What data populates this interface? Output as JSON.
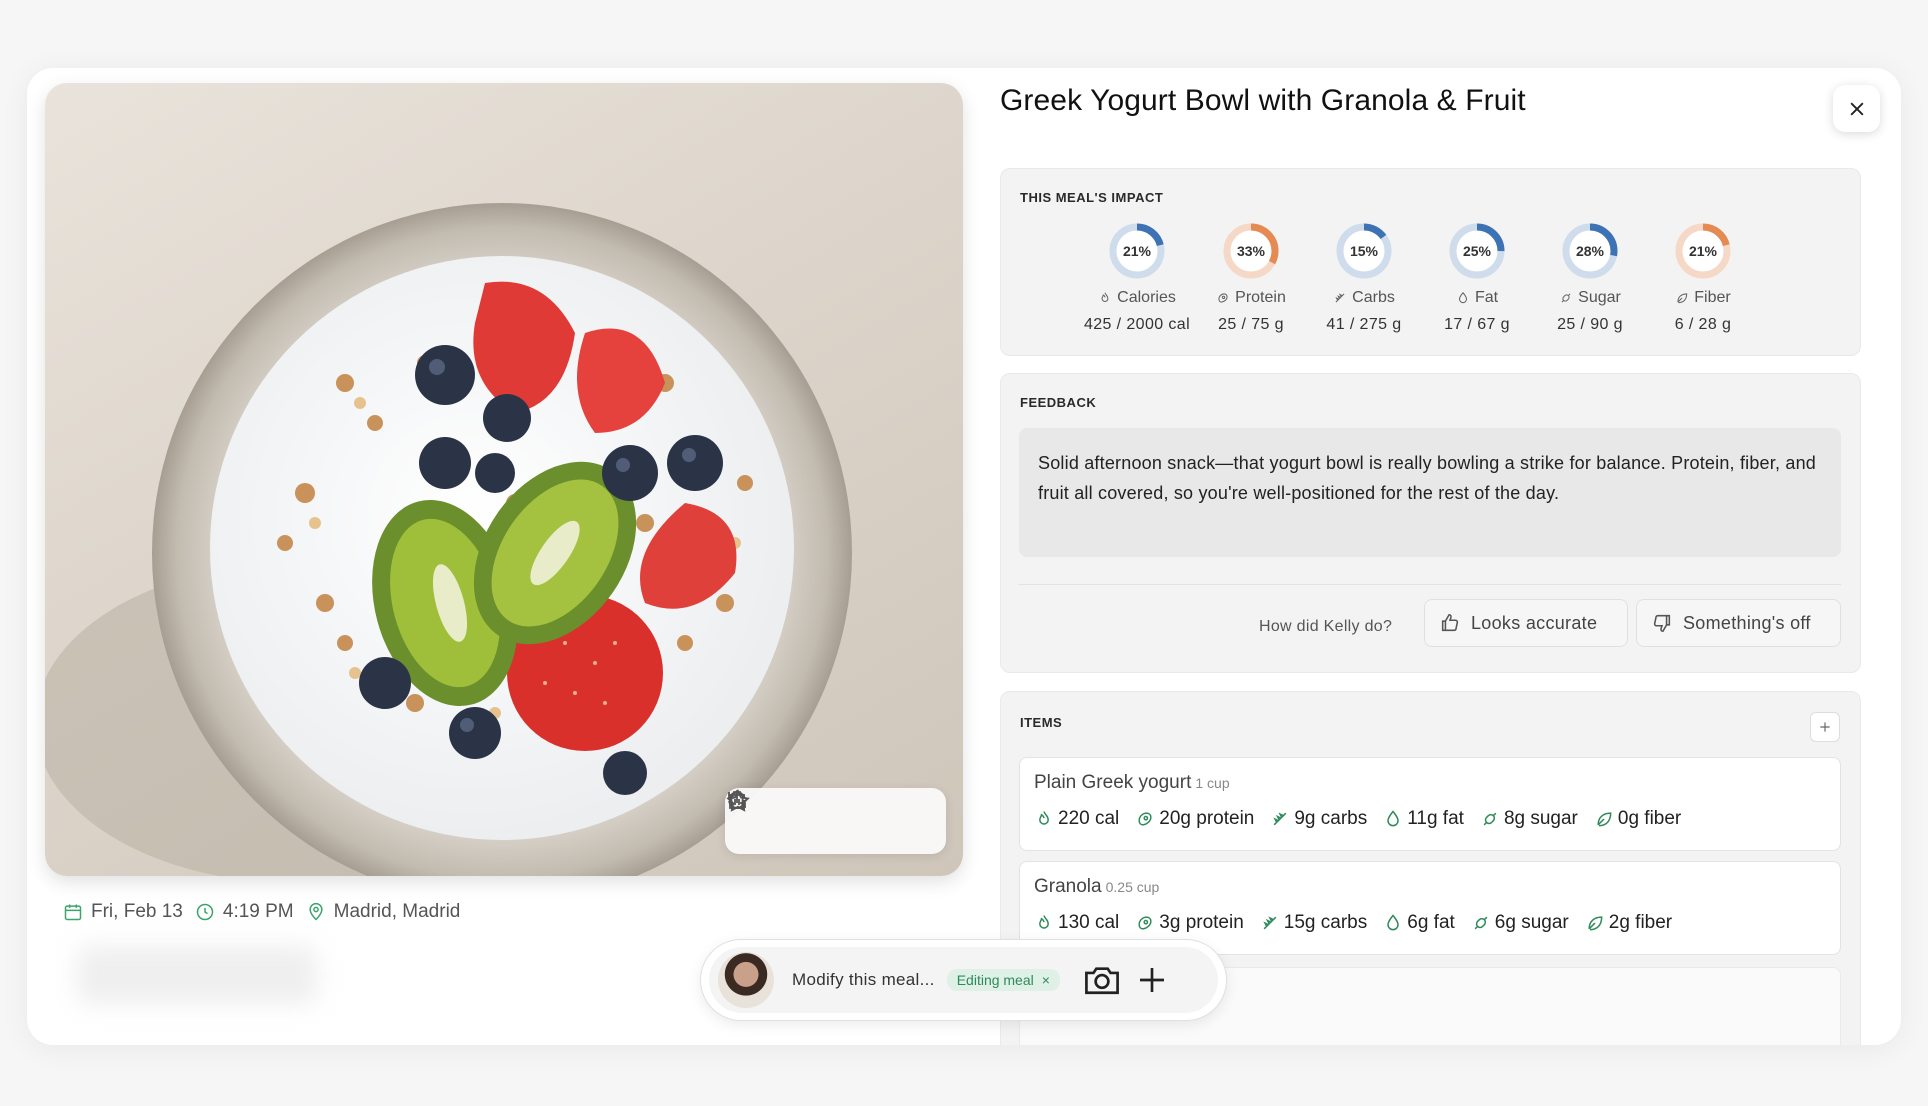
{
  "meal": {
    "title": "Greek Yogurt Bowl with Granola & Fruit"
  },
  "meta": {
    "date": "Fri, Feb 13",
    "time": "4:19 PM",
    "location": "Madrid, Madrid"
  },
  "impact": {
    "heading": "THIS MEAL'S IMPACT",
    "metrics": [
      {
        "pct": "21%",
        "label": "Calories",
        "value": "425 / 2000 cal",
        "icon": "flame-icon",
        "fraction": 0.21,
        "color": "#3d72b4"
      },
      {
        "pct": "33%",
        "label": "Protein",
        "value": "25 / 75 g",
        "icon": "steak-icon",
        "fraction": 0.33,
        "color": "#e58a53"
      },
      {
        "pct": "15%",
        "label": "Carbs",
        "value": "41 / 275 g",
        "icon": "wheat-icon",
        "fraction": 0.15,
        "color": "#3d72b4"
      },
      {
        "pct": "25%",
        "label": "Fat",
        "value": "17 / 67 g",
        "icon": "drop-icon",
        "fraction": 0.25,
        "color": "#3d72b4"
      },
      {
        "pct": "28%",
        "label": "Sugar",
        "value": "25 / 90 g",
        "icon": "candy-icon",
        "fraction": 0.28,
        "color": "#3d72b4"
      },
      {
        "pct": "21%",
        "label": "Fiber",
        "value": "6 / 28 g",
        "icon": "leaf-icon",
        "fraction": 0.21,
        "color": "#e58a53"
      }
    ]
  },
  "feedback": {
    "heading": "FEEDBACK",
    "text": "Solid afternoon snack—that yogurt bowl is really bowling a strike for balance. Protein, fiber, and fruit all covered, so you're well-positioned for the rest of the day.",
    "question": "How did Kelly do?",
    "accurate_label": "Looks accurate",
    "off_label": "Something's off"
  },
  "items": {
    "heading": "ITEMS",
    "list": [
      {
        "name": "Plain Greek yogurt",
        "qty": "1 cup",
        "cal": "220 cal",
        "protein": "20g protein",
        "carbs": "9g carbs",
        "fat": "11g fat",
        "sugar": "8g sugar",
        "fiber": "0g fiber"
      },
      {
        "name": "Granola",
        "qty": "0.25 cup",
        "cal": "130 cal",
        "protein": "3g protein",
        "carbs": "15g carbs",
        "fat": "6g fat",
        "sugar": "6g sugar",
        "fiber": "2g fiber"
      }
    ]
  },
  "chat": {
    "placeholder": "Modify this meal...",
    "tag": "Editing meal"
  },
  "colors": {
    "accent_green": "#2f8a5a",
    "ring_blue": "#3d72b4",
    "ring_orange": "#e58a53"
  }
}
